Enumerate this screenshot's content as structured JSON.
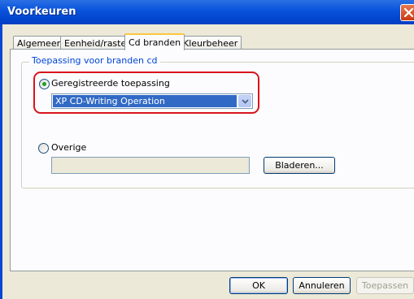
{
  "window": {
    "title": "Voorkeuren"
  },
  "tabs": [
    {
      "label": "Algemeen"
    },
    {
      "label": "Eenheid/raster"
    },
    {
      "label": "Cd branden"
    },
    {
      "label": "Kleurbeheer"
    }
  ],
  "active_tab": "Cd branden",
  "group": {
    "label": "Toepassing voor branden cd",
    "registered": {
      "label": "Geregistreerde toepassing",
      "selected": true
    },
    "application_select": {
      "value": "XP CD-Writing Operation"
    },
    "other": {
      "label": "Overige",
      "selected": false,
      "path_value": ""
    },
    "browse_label": "Bladeren..."
  },
  "buttons": {
    "ok": "OK",
    "cancel": "Annuleren",
    "apply": "Toepassen"
  },
  "colors": {
    "titlebar": "#0a55dd",
    "highlight": "#d8141c",
    "group_label": "#0046d5",
    "selection": "#316ac5"
  }
}
